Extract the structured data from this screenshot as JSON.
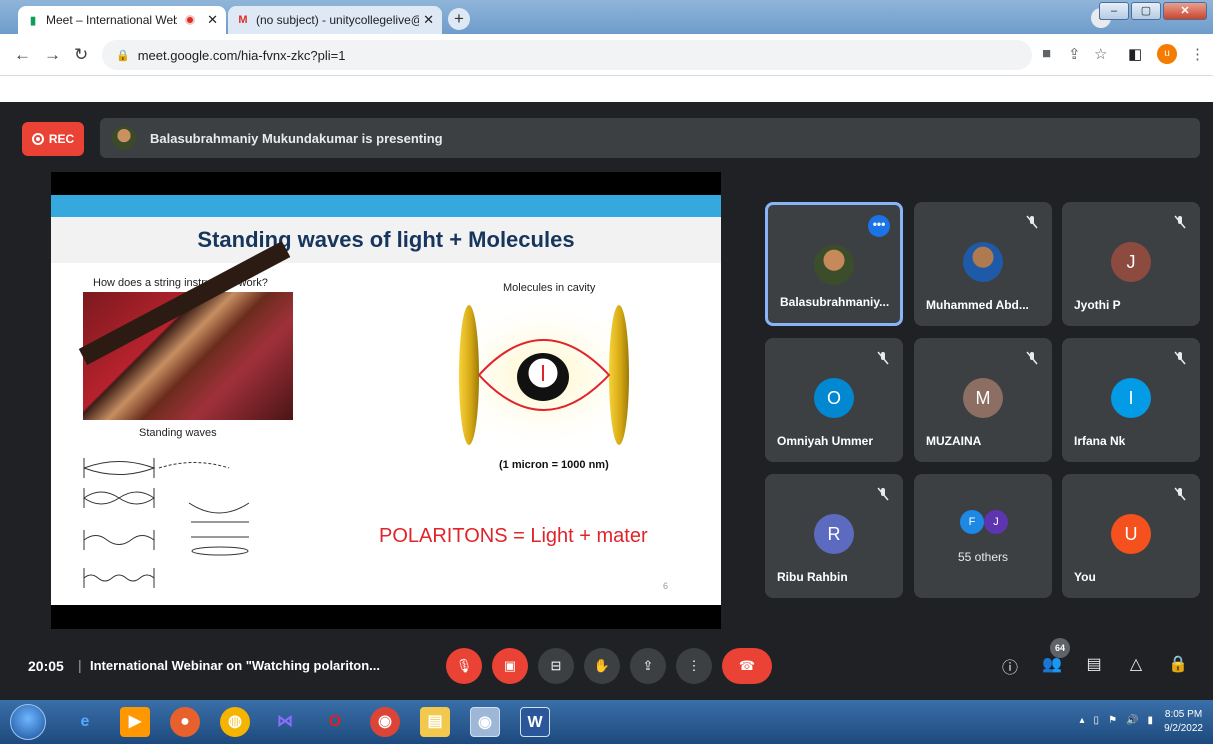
{
  "browser": {
    "tabs": [
      {
        "title": "Meet – International Webina",
        "favicon": "meet-icon",
        "active": true
      },
      {
        "title": "(no subject) - unitycollegelive@u",
        "favicon": "gmail-icon",
        "active": false
      }
    ],
    "url": "meet.google.com/hia-fvnx-zkc?pli=1",
    "profile_initial": "u"
  },
  "meet": {
    "rec_label": "REC",
    "presenting_text": "Balasubrahmaniy Mukundakumar is presenting",
    "slide": {
      "title": "Standing waves of light + Molecules",
      "question": "How does a string instrument work?",
      "standing_waves_label": "Standing waves",
      "molecules_label": "Molecules in cavity",
      "micron_label": "(1 micron = 1000 nm)",
      "polaritons_text": "POLARITONS = Light + mater",
      "page_number": "6"
    },
    "participants": [
      {
        "name": "Balasubrahmaniy...",
        "avatar": "photo",
        "muted": false,
        "active": true
      },
      {
        "name": "Muhammed Abd...",
        "avatar": "photo",
        "muted": true,
        "active": false
      },
      {
        "name": "Jyothi P",
        "initial": "J",
        "color": "#8d4b3f",
        "muted": true
      },
      {
        "name": "Omniyah Ummer",
        "initial": "O",
        "color": "#0288d1",
        "muted": true
      },
      {
        "name": "MUZAINA",
        "initial": "M",
        "color": "#8d6e63",
        "muted": true
      },
      {
        "name": "Irfana Nk",
        "initial": "I",
        "color": "#039be5",
        "muted": true
      },
      {
        "name": "Ribu Rahbin",
        "initial": "R",
        "color": "#5c6bc0",
        "muted": true
      },
      {
        "name": "You",
        "initial": "U",
        "color": "#f4511e",
        "muted": true
      }
    ],
    "others": {
      "label": "55 others",
      "initials": [
        "F",
        "J"
      ],
      "colors": [
        "#1e88e5",
        "#5e35b1"
      ]
    },
    "bottom": {
      "time": "20:05",
      "separator": "|",
      "meeting_title": "International Webinar on \"Watching polariton...",
      "people_count": "64"
    }
  },
  "taskbar": {
    "time": "8:05 PM",
    "date": "9/2/2022"
  }
}
